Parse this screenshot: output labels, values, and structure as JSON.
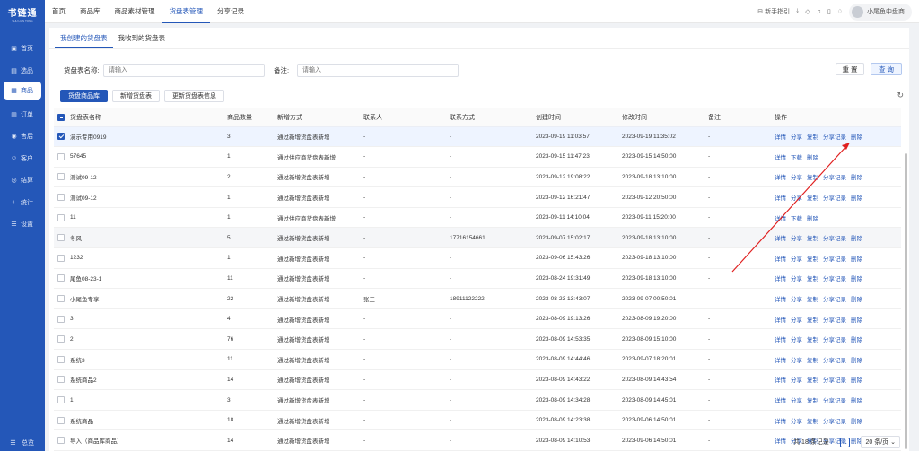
{
  "sidebar": {
    "logo_title": "书链通",
    "logo_sub": "SHU LIAN TONG",
    "items": [
      {
        "label": "首页",
        "icon": "home-icon",
        "glyph": "▣"
      },
      {
        "label": "选品",
        "icon": "select-icon",
        "glyph": "▤"
      },
      {
        "label": "商品",
        "icon": "goods-icon",
        "glyph": "▦"
      },
      {
        "label": "订单",
        "icon": "order-icon",
        "glyph": "▥"
      },
      {
        "label": "售后",
        "icon": "aftersale-icon",
        "glyph": "◉"
      },
      {
        "label": "客户",
        "icon": "customer-icon",
        "glyph": "☺"
      },
      {
        "label": "结算",
        "icon": "settle-icon",
        "glyph": "◎"
      },
      {
        "label": "统计",
        "icon": "stats-icon",
        "glyph": "◐"
      },
      {
        "label": "设置",
        "icon": "settings-icon",
        "glyph": "☰"
      }
    ],
    "active_index": 2,
    "collapse_label": "总览",
    "collapse_glyph": "☰"
  },
  "topbar": {
    "tabs": [
      "首页",
      "商品库",
      "商品素材管理",
      "货盘表管理",
      "分享记录"
    ],
    "active_index": 3,
    "guide_label": "新手指引",
    "user_name": "小尾鱼中盘商"
  },
  "subtabs": [
    "我创建的货盘表",
    "我收到的货盘表"
  ],
  "filters": {
    "name_label": "货盘表名称:",
    "name_placeholder": "请输入",
    "remark_label": "备注:",
    "remark_placeholder": "请输入",
    "reset": "重 置",
    "query": "查 询"
  },
  "actions": [
    "货盘商品库",
    "新增货盘表",
    "更新货盘表信息"
  ],
  "table": {
    "headers": [
      "货盘表名称",
      "商品数量",
      "新增方式",
      "联系人",
      "联系方式",
      "创建时间",
      "修改时间",
      "备注",
      "操作"
    ],
    "rows": [
      {
        "name": "演示专用0919",
        "count": "3",
        "method": "通过新增货盘表新增",
        "contact": "-",
        "phone": "-",
        "created": "2023-09-19 11:03:57",
        "modified": "2023-09-19 11:35:02",
        "remark": "-",
        "ops": [
          "详情",
          "分享",
          "复制",
          "分享记录",
          "删除"
        ],
        "checked": true
      },
      {
        "name": "57645",
        "count": "1",
        "method": "通过供应商货盘表新增",
        "contact": "-",
        "phone": "-",
        "created": "2023-09-15 11:47:23",
        "modified": "2023-09-15 14:50:00",
        "remark": "-",
        "ops": [
          "详情",
          "下载",
          "删除"
        ],
        "checked": false
      },
      {
        "name": "测试09-12",
        "count": "2",
        "method": "通过新增货盘表新增",
        "contact": "-",
        "phone": "-",
        "created": "2023-09-12 19:08:22",
        "modified": "2023-09-18 13:10:00",
        "remark": "-",
        "ops": [
          "详情",
          "分享",
          "复制",
          "分享记录",
          "删除"
        ],
        "checked": false
      },
      {
        "name": "测试09-12",
        "count": "1",
        "method": "通过新增货盘表新增",
        "contact": "-",
        "phone": "-",
        "created": "2023-09-12 16:21:47",
        "modified": "2023-09-12 20:50:00",
        "remark": "-",
        "ops": [
          "详情",
          "分享",
          "复制",
          "分享记录",
          "删除"
        ],
        "checked": false
      },
      {
        "name": "11",
        "count": "1",
        "method": "通过供应商货盘表新增",
        "contact": "-",
        "phone": "-",
        "created": "2023-09-11 14:10:04",
        "modified": "2023-09-11 15:20:00",
        "remark": "-",
        "ops": [
          "详情",
          "下载",
          "删除"
        ],
        "checked": false
      },
      {
        "name": "冬风",
        "count": "5",
        "method": "通过新增货盘表新增",
        "contact": "-",
        "phone": "17716154661",
        "created": "2023-09-07 15:02:17",
        "modified": "2023-09-18 13:10:00",
        "remark": "-",
        "ops": [
          "详情",
          "分享",
          "复制",
          "分享记录",
          "删除"
        ],
        "checked": false
      },
      {
        "name": "1232",
        "count": "1",
        "method": "通过新增货盘表新增",
        "contact": "-",
        "phone": "-",
        "created": "2023-09-06 15:43:26",
        "modified": "2023-09-18 13:10:00",
        "remark": "-",
        "ops": [
          "详情",
          "分享",
          "复制",
          "分享记录",
          "删除"
        ],
        "checked": false
      },
      {
        "name": "尾鱼08-23-1",
        "count": "11",
        "method": "通过新增货盘表新增",
        "contact": "-",
        "phone": "-",
        "created": "2023-08-24 19:31:49",
        "modified": "2023-09-18 13:10:00",
        "remark": "-",
        "ops": [
          "详情",
          "分享",
          "复制",
          "分享记录",
          "删除"
        ],
        "checked": false
      },
      {
        "name": "小尾鱼专享",
        "count": "22",
        "method": "通过新增货盘表新增",
        "contact": "张三",
        "phone": "18911122222",
        "created": "2023-08-23 13:43:07",
        "modified": "2023-09-07 00:50:01",
        "remark": "-",
        "ops": [
          "详情",
          "分享",
          "复制",
          "分享记录",
          "删除"
        ],
        "checked": false
      },
      {
        "name": "3",
        "count": "4",
        "method": "通过新增货盘表新增",
        "contact": "-",
        "phone": "-",
        "created": "2023-08-09 19:13:26",
        "modified": "2023-08-09 19:20:00",
        "remark": "-",
        "ops": [
          "详情",
          "分享",
          "复制",
          "分享记录",
          "删除"
        ],
        "checked": false
      },
      {
        "name": "2",
        "count": "76",
        "method": "通过新增货盘表新增",
        "contact": "-",
        "phone": "-",
        "created": "2023-08-09 14:53:35",
        "modified": "2023-08-09 15:10:00",
        "remark": "-",
        "ops": [
          "详情",
          "分享",
          "复制",
          "分享记录",
          "删除"
        ],
        "checked": false
      },
      {
        "name": "系统3",
        "count": "11",
        "method": "通过新增货盘表新增",
        "contact": "-",
        "phone": "-",
        "created": "2023-08-09 14:44:46",
        "modified": "2023-09-07 18:20:01",
        "remark": "-",
        "ops": [
          "详情",
          "分享",
          "复制",
          "分享记录",
          "删除"
        ],
        "checked": false
      },
      {
        "name": "系统商品2",
        "count": "14",
        "method": "通过新增货盘表新增",
        "contact": "-",
        "phone": "-",
        "created": "2023-08-09 14:43:22",
        "modified": "2023-08-09 14:43:54",
        "remark": "-",
        "ops": [
          "详情",
          "分享",
          "复制",
          "分享记录",
          "删除"
        ],
        "checked": false
      },
      {
        "name": "1",
        "count": "3",
        "method": "通过新增货盘表新增",
        "contact": "-",
        "phone": "-",
        "created": "2023-08-09 14:34:28",
        "modified": "2023-08-09 14:45:01",
        "remark": "-",
        "ops": [
          "详情",
          "分享",
          "复制",
          "分享记录",
          "删除"
        ],
        "checked": false
      },
      {
        "name": "系统商品",
        "count": "18",
        "method": "通过新增货盘表新增",
        "contact": "-",
        "phone": "-",
        "created": "2023-08-09 14:23:38",
        "modified": "2023-09-06 14:50:01",
        "remark": "-",
        "ops": [
          "详情",
          "分享",
          "复制",
          "分享记录",
          "删除"
        ],
        "checked": false
      },
      {
        "name": "导入（商品库商品）",
        "count": "14",
        "method": "通过新增货盘表新增",
        "contact": "-",
        "phone": "-",
        "created": "2023-08-09 14:10:53",
        "modified": "2023-09-06 14:50:01",
        "remark": "-",
        "ops": [
          "详情",
          "分享",
          "复制",
          "分享记录",
          "删除"
        ],
        "checked": false
      }
    ]
  },
  "pager": {
    "total": "共 18 条记录",
    "page": "1",
    "size": "20 条/页"
  },
  "colors": {
    "primary": "#2457b8",
    "arrow": "#e02020"
  }
}
